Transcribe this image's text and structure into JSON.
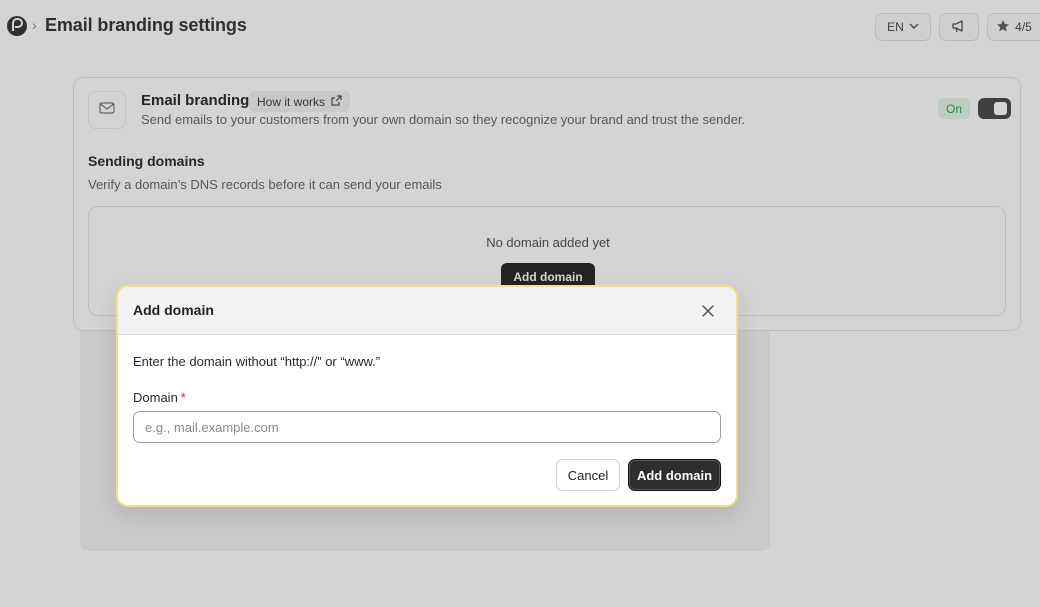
{
  "header": {
    "breadcrumb_sep": "›",
    "page_title": "Email branding settings",
    "lang_label": "EN",
    "rating_label": "4/5"
  },
  "branding": {
    "title": "Email branding",
    "how_it_works": "How it works",
    "description": "Send emails to your customers from your own domain so they recognize your brand and trust the sender.",
    "status": "On",
    "status_color": "#39a153"
  },
  "sending_domains": {
    "title": "Sending domains",
    "description": "Verify a domain’s DNS records before it can send your emails",
    "empty_text": "No domain added yet",
    "add_button": "Add domain"
  },
  "modal": {
    "title": "Add domain",
    "hint": "Enter the domain without “http://” or “www.”",
    "field_label": "Domain",
    "required_mark": "*",
    "input_value": "",
    "input_placeholder": "e.g., mail.example.com",
    "cancel_label": "Cancel",
    "submit_label": "Add domain",
    "accent_border": "#efe08a"
  },
  "icons": {
    "logo": "app-logo-icon",
    "lang_chevron": "chevron-down-icon",
    "announce": "megaphone-icon",
    "rating": "star-icon",
    "mail": "mail-icon",
    "external": "external-link-icon",
    "close": "close-icon"
  }
}
